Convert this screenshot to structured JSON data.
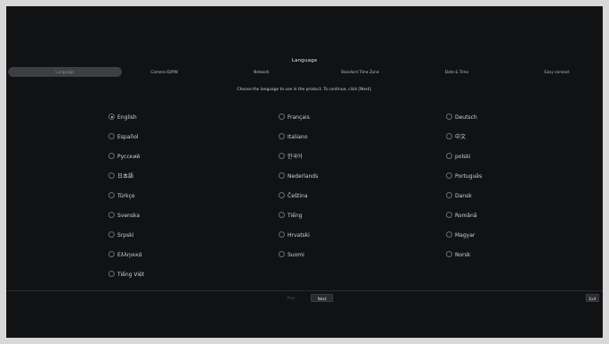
{
  "header": {
    "title": "Language"
  },
  "steps": [
    "Language",
    "Camera ID/PW",
    "Network",
    "Standard Time Zone",
    "Date & Time",
    "Easy connect"
  ],
  "instruction": "Choose the language to use in the product. To continue, click [Next].",
  "languages": [
    "English",
    "Français",
    "Deutsch",
    "Español",
    "Italiano",
    "中文",
    "Русский",
    "한국어",
    "polski",
    "日本語",
    "Nederlands",
    "Português",
    "Türkçe",
    "Čeština",
    "Dansk",
    "Svenska",
    "Tiếng",
    "Română",
    "Srpski",
    "Hrvatski",
    "Magyar",
    "Ελληνικά",
    "Suomi",
    "Norsk",
    "Tiếng Việt"
  ],
  "selected_language": "English",
  "footer": {
    "previous_label": "Prev",
    "next_label": "Next",
    "exit_label": "Exit"
  }
}
